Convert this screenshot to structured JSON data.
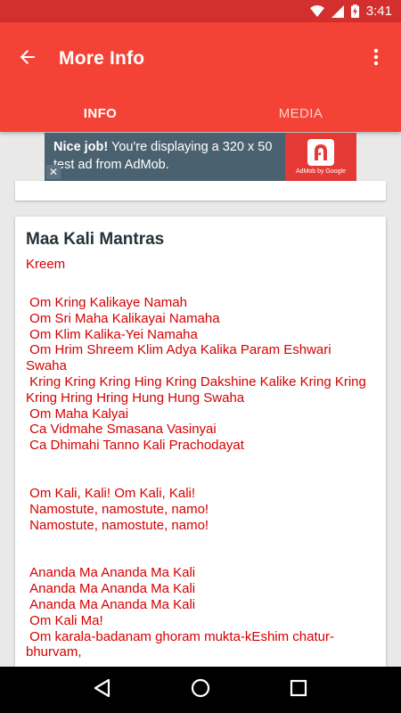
{
  "status_bar": {
    "time": "3:41",
    "icons": [
      "wifi-icon",
      "signal-icon",
      "battery-charging-icon"
    ]
  },
  "app_bar": {
    "title": "More Info",
    "back_icon": "arrow-back-icon",
    "overflow_icon": "more-vert-icon"
  },
  "tabs": [
    {
      "label": "INFO",
      "active": true
    },
    {
      "label": "MEDIA",
      "active": false
    }
  ],
  "ad": {
    "headline": "Nice job!",
    "body": " You're displaying a 320 x 50 test ad from AdMob.",
    "brand": "AdMob by Google",
    "close": "✕"
  },
  "card": {
    "title": "Maa Kali Mantras",
    "subtitle": "Kreem",
    "blocks": [
      [
        " Om Kring Kalikaye Namah",
        " Om Sri Maha Kalikayai Namaha",
        " Om Klim Kalika-Yei Namaha",
        " Om Hrim Shreem Klim Adya Kalika Param Eshwari Swaha",
        " Kring Kring Kring Hing Kring Dakshine Kalike Kring Kring Kring Hring Hring Hung Hung Swaha",
        " Om Maha Kalyai",
        " Ca Vidmahe Smasana Vasinyai",
        " Ca Dhimahi Tanno Kali Prachodayat"
      ],
      [
        " Om Kali, Kali! Om Kali, Kali!",
        " Namostute, namostute, namo!",
        " Namostute, namostute, namo!"
      ],
      [
        " Ananda Ma Ananda Ma Kali",
        " Ananda Ma Ananda Ma Kali",
        " Ananda Ma Ananda Ma Kali",
        " Om Kali Ma!",
        " Om karala-badanam ghoram mukta-kEshim chatur-bhurvam,"
      ]
    ]
  },
  "nav_bar": {
    "icons": [
      "nav-back-icon",
      "nav-home-icon",
      "nav-recents-icon"
    ]
  }
}
